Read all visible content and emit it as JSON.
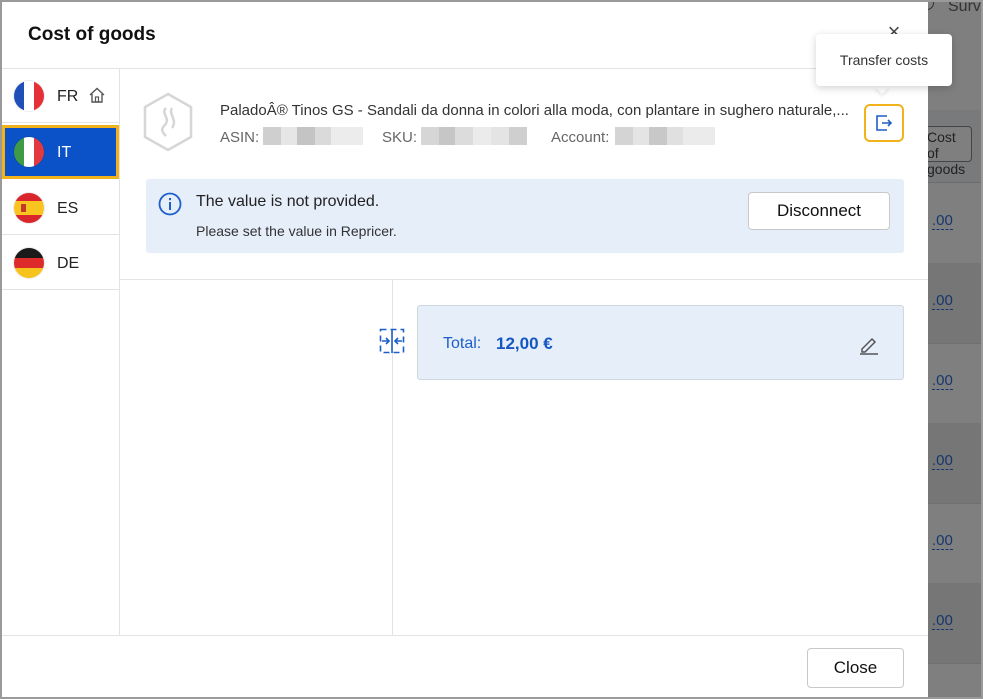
{
  "modal": {
    "title": "Cost of goods",
    "close_x": "×",
    "close_button": "Close"
  },
  "marketplaces": [
    {
      "code": "FR",
      "home": true,
      "active": false
    },
    {
      "code": "IT",
      "home": false,
      "active": true
    },
    {
      "code": "ES",
      "home": false,
      "active": false
    },
    {
      "code": "DE",
      "home": false,
      "active": false
    }
  ],
  "product": {
    "title": "PaladoÂ® Tinos GS - Sandali da donna in colori alla moda, con plantare in sughero naturale,...",
    "asin_label": "ASIN:",
    "sku_label": "SKU:",
    "account_label": "Account:"
  },
  "tooltip": "Transfer costs",
  "info": {
    "title": "The value is not provided.",
    "subtitle": "Please set the value in Repricer.",
    "disconnect": "Disconnect"
  },
  "total": {
    "label": "Total:",
    "value": "12,00 €"
  },
  "background": {
    "top_text": "Surv",
    "header_button": "Cost of goods",
    "row_values": [
      ".00",
      ".00",
      ".00",
      ".00",
      ".00",
      ".00"
    ]
  },
  "colors": {
    "primary": "#0b52c8",
    "highlight": "#f2b21b",
    "info_bg": "#e6eefa"
  }
}
